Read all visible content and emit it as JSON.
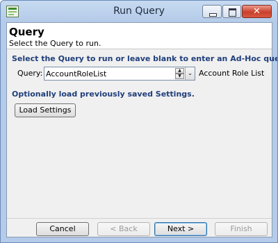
{
  "window": {
    "title": "Run Query",
    "icon": "spreadsheet-app-icon",
    "close_glyph": "✕"
  },
  "header": {
    "title": "Query",
    "subtitle": "Select the Query to run."
  },
  "query_section": {
    "instruction": "Select the Query to run or leave blank to enter an Ad-Hoc query.",
    "label": "Query:",
    "value": "AccountRoleList",
    "description": "Account Role List",
    "spin_up": "▲",
    "spin_down": "▼",
    "dropdown": "⌄"
  },
  "settings_section": {
    "instruction": "Optionally load previously saved Settings.",
    "load_button": "Load Settings"
  },
  "footer": {
    "cancel": "Cancel",
    "back": "< Back",
    "next": "Next >",
    "finish": "Finish"
  },
  "colors": {
    "accent_text": "#1f3e7a",
    "titlebar": "#b4cbe9",
    "close_button": "#c8412d"
  }
}
